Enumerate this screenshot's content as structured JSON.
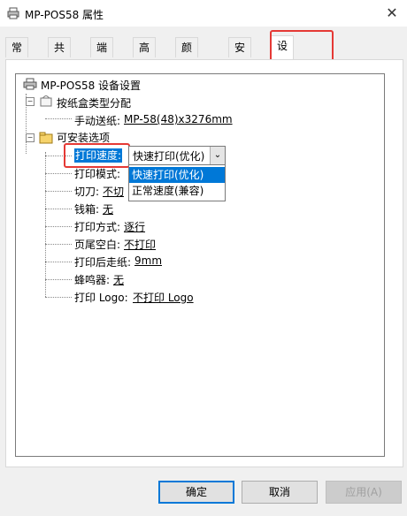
{
  "window": {
    "title": "MP-POS58 属性",
    "close_glyph": "✕"
  },
  "tabs": [
    {
      "label": "常规"
    },
    {
      "label": "共享"
    },
    {
      "label": "端口"
    },
    {
      "label": "高级"
    },
    {
      "label": "颜色管理"
    },
    {
      "label": "安全"
    },
    {
      "label": "设备设置"
    }
  ],
  "tree": {
    "root": "MP-POS58 设备设置",
    "paper_group": "按纸盒类型分配",
    "manual_feed_label": "手动送纸:",
    "manual_feed_value": "MP-58(48)x3276mm",
    "options_group": "可安装选项",
    "print_speed_label": "打印速度:",
    "print_mode_label": "打印模式:",
    "print_mode_value": "",
    "cutter_label": "切刀:",
    "cutter_value": "不切",
    "cash_drawer_label": "钱箱:",
    "cash_drawer_value": "无",
    "print_method_label": "打印方式:",
    "print_method_value": "逐行",
    "footer_blank_label": "页尾空白:",
    "footer_blank_value": "不打印",
    "feed_after_label": "打印后走纸:",
    "feed_after_value": "9mm",
    "buzzer_label": "蜂鸣器:",
    "buzzer_value": "无",
    "logo_label": "打印 Logo:",
    "logo_value": "不打印 Logo"
  },
  "speed_combo": {
    "selected": "快速打印(优化)",
    "options": [
      "快速打印(优化)",
      "正常速度(兼容)"
    ]
  },
  "buttons": {
    "ok": "确定",
    "cancel": "取消",
    "apply": "应用(A)"
  },
  "colors": {
    "accent": "#0078d7",
    "highlight_box": "#e53935"
  }
}
